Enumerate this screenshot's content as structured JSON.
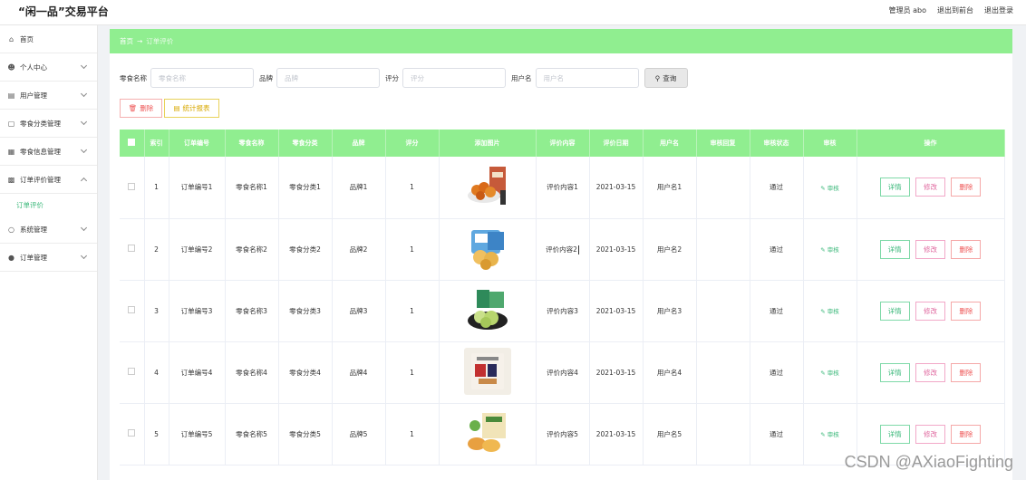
{
  "header": {
    "title": "“闲一品”交易平台",
    "admin": "管理员 abo",
    "to_front": "退出到前台",
    "logout": "退出登录"
  },
  "sidebar": {
    "items": [
      {
        "label": "首页",
        "icon": "home-icon"
      },
      {
        "label": "个人中心",
        "icon": "user-icon"
      },
      {
        "label": "用户管理",
        "icon": "users-icon"
      },
      {
        "label": "零食分类管理",
        "icon": "category-icon"
      },
      {
        "label": "零食信息管理",
        "icon": "info-icon"
      },
      {
        "label": "订单评价管理",
        "icon": "order-review-icon"
      },
      {
        "label": "系统管理",
        "icon": "settings-icon"
      },
      {
        "label": "订单管理",
        "icon": "order-icon"
      }
    ],
    "sub_item": "订单评价"
  },
  "breadcrumb": {
    "home": "首页",
    "arrow": "→",
    "current": "订单评价"
  },
  "search": {
    "f1_label": "零食名称",
    "f1_placeholder": "零食名称",
    "f2_label": "品牌",
    "f2_placeholder": "品牌",
    "f3_label": "评分",
    "f3_placeholder": "评分",
    "f4_label": "用户名",
    "f4_placeholder": "用户名",
    "button": "查询"
  },
  "actions": {
    "delete": "删除",
    "stats": "统计报表"
  },
  "table": {
    "headers": [
      "索引",
      "订单编号",
      "零食名称",
      "零食分类",
      "品牌",
      "评分",
      "添加图片",
      "评价内容",
      "评价日期",
      "用户名",
      "审核回复",
      "审核状态",
      "审核",
      "操作"
    ],
    "approve_label": "审核",
    "op_detail": "详情",
    "op_edit": "修改",
    "op_delete": "删除",
    "rows": [
      {
        "idx": "1",
        "order": "订单编号1",
        "name": "零食名称1",
        "cat": "零食分类1",
        "brand": "品牌1",
        "score": "1",
        "content": "评价内容1",
        "date": "2021-03-15",
        "user": "用户名1",
        "reply": "",
        "status": "通过"
      },
      {
        "idx": "2",
        "order": "订单编号2",
        "name": "零食名称2",
        "cat": "零食分类2",
        "brand": "品牌2",
        "score": "1",
        "content": "评价内容2",
        "date": "2021-03-15",
        "user": "用户名2",
        "reply": "",
        "status": "通过"
      },
      {
        "idx": "3",
        "order": "订单编号3",
        "name": "零食名称3",
        "cat": "零食分类3",
        "brand": "品牌3",
        "score": "1",
        "content": "评价内容3",
        "date": "2021-03-15",
        "user": "用户名3",
        "reply": "",
        "status": "通过"
      },
      {
        "idx": "4",
        "order": "订单编号4",
        "name": "零食名称4",
        "cat": "零食分类4",
        "brand": "品牌4",
        "score": "1",
        "content": "评价内容4",
        "date": "2021-03-15",
        "user": "用户名4",
        "reply": "",
        "status": "通过"
      },
      {
        "idx": "5",
        "order": "订单编号5",
        "name": "零食名称5",
        "cat": "零食分类5",
        "brand": "品牌5",
        "score": "1",
        "content": "评价内容5",
        "date": "2021-03-15",
        "user": "用户名5",
        "reply": "",
        "status": "通过"
      }
    ]
  },
  "watermark": "CSDN @AXiaoFighting",
  "colors": {
    "accent": "#90ee90",
    "text_green": "#3bb87a"
  }
}
